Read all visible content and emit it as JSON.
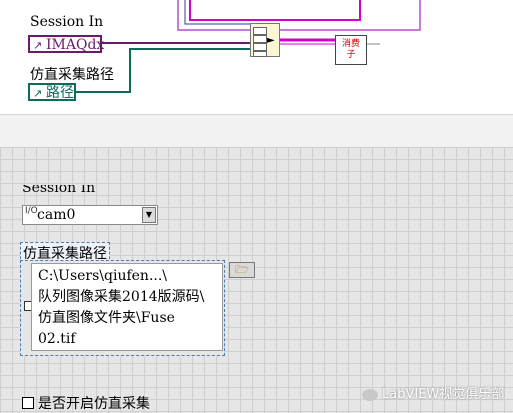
{
  "diagram": {
    "session_label": "Session In",
    "imaq_terminal": "IMAQdx",
    "path_label": "仿直采集路径",
    "path_terminal": "路径",
    "consume_node": "消费\n子",
    "colors": {
      "imaq_wire": "#6a1b6a",
      "path_wire": "#0d6b5a",
      "cluster_wire": "#d000d0"
    }
  },
  "panel": {
    "session_label": "Session In",
    "session_io_icon": "I/O",
    "session_value": "cam0",
    "path_label": "仿直采集路径",
    "path_value": "C:\\Users\\qiufen...\\\n队列图像采集2014版源码\\\n仿直图像文件夹\\Fuse\n02.tif",
    "browse_icon": "folder-open-icon",
    "simulate_label": "是否开启仿直采集",
    "simulate_checked": false,
    "watermark": "LabVIEW视觉俱乐部"
  }
}
